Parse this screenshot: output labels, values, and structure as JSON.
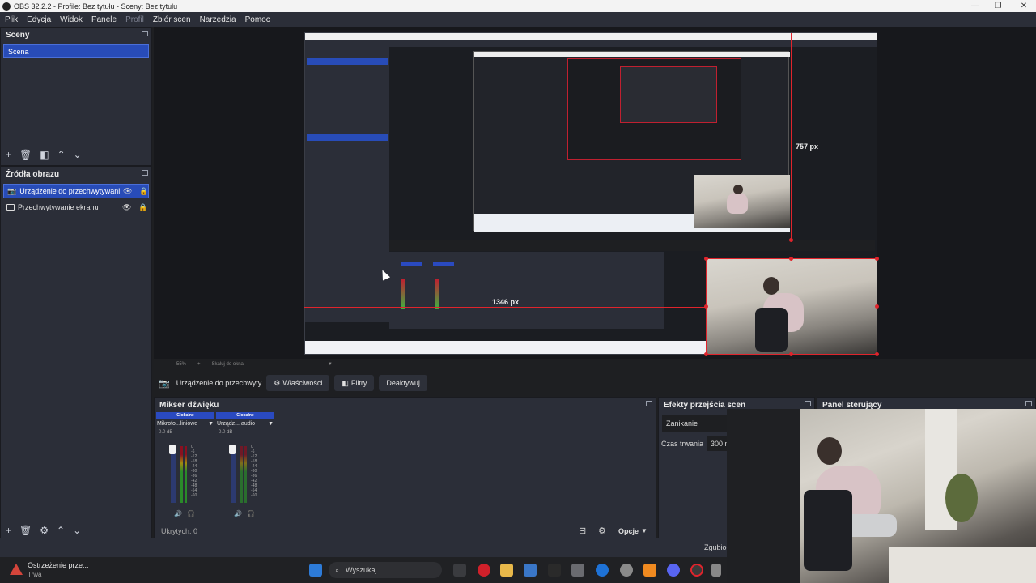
{
  "window": {
    "title": "OBS 32.2.2 - Profile: Bez tytułu - Sceny: Bez tytułu",
    "controls": [
      "—",
      "❐",
      "✕"
    ]
  },
  "menu": [
    "Plik",
    "Edycja",
    "Widok",
    "Panele",
    "Profil",
    "Zbiór scen",
    "Narzędzia",
    "Pomoc"
  ],
  "scenes": {
    "title": "Sceny",
    "items": [
      "Scena"
    ]
  },
  "sources": {
    "title": "Źródła obrazu",
    "items": [
      "Urządzenie do przechwytywani",
      "Przechwytywanie ekranu"
    ]
  },
  "preview": {
    "label_width": "757 px",
    "label_height": "1346 px",
    "zoom": "55%",
    "scale_label": "Skaluj do okna"
  },
  "context_bar": {
    "source": "Urządzenie do przechwyty",
    "properties": "Właściwości",
    "filters": "Filtry",
    "deactivate": "Deaktywuj"
  },
  "mixer": {
    "title": "Mikser dźwięku",
    "channels": [
      {
        "header": "Globalne",
        "name": "Mikrofo...liniowe",
        "db": "0.0 dB"
      },
      {
        "header": "Globalne",
        "name": "Urządz... audio",
        "db": "0.0 dB"
      }
    ],
    "scale": [
      "0",
      "-6",
      "-12",
      "-18",
      "-24",
      "-30",
      "-36",
      "-42",
      "-48",
      "-54",
      "-60"
    ],
    "hidden": "Ukrytych: 0",
    "options": "Opcje"
  },
  "transitions": {
    "title": "Efekty przejścia scen",
    "transition": "Zanikanie",
    "duration_label": "Czas trwania",
    "duration_value": "300 m"
  },
  "controls_panel": {
    "title": "Panel sterujący",
    "status": "Zgubio"
  },
  "taskbar": {
    "notification_title": "Ostrzeżenie prze...",
    "notification_sub": "Trwa",
    "search_placeholder": "Wyszukaj"
  },
  "colors": {
    "accent": "#284cb8",
    "panel": "#2b2e38",
    "background": "#1e1f22",
    "guide_red": "#e0242c"
  }
}
